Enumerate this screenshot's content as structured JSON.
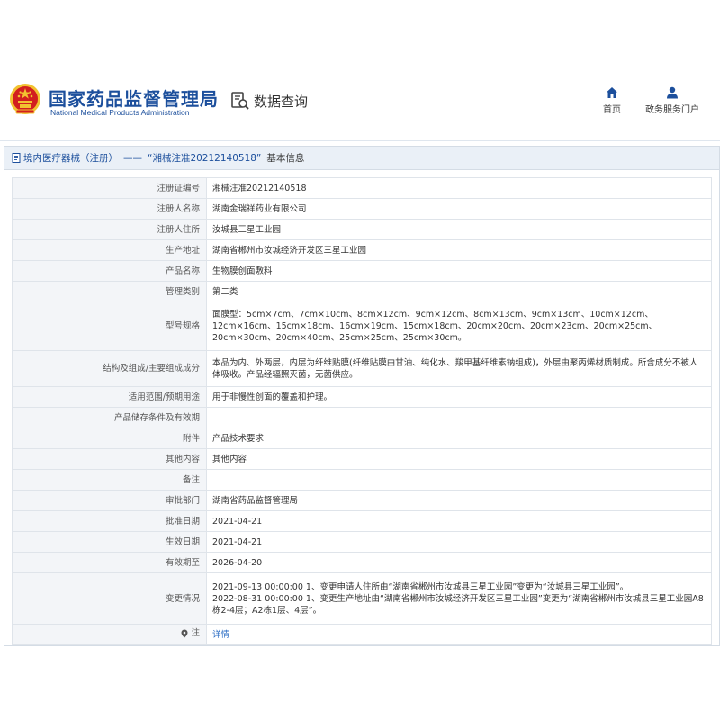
{
  "header": {
    "title": "国家药品监督管理局",
    "subtitle": "National Medical Products Administration",
    "query_label": "数据查询",
    "nav": {
      "home_label": "首页",
      "portal_label": "政务服务门户"
    }
  },
  "section": {
    "category": "境内医疗器械（注册）",
    "dash": "——",
    "record_quoted": "“湘械注准20212140518”",
    "suffix": "基本信息"
  },
  "rows": [
    {
      "label": "注册证编号",
      "value": "湘械注准20212140518"
    },
    {
      "label": "注册人名称",
      "value": "湖南金瑞祥药业有限公司"
    },
    {
      "label": "注册人住所",
      "value": "汝城县三星工业园"
    },
    {
      "label": "生产地址",
      "value": "湖南省郴州市汝城经济开发区三星工业园"
    },
    {
      "label": "产品名称",
      "value": "生物膜创面敷料"
    },
    {
      "label": "管理类别",
      "value": "第二类"
    },
    {
      "label": "型号规格",
      "value": "面膜型：5cm×7cm、7cm×10cm、8cm×12cm、9cm×12cm、8cm×13cm、9cm×13cm、10cm×12cm、12cm×16cm、15cm×18cm、16cm×19cm、15cm×18cm、20cm×20cm、20cm×23cm、20cm×25cm、20cm×30cm、20cm×40cm、25cm×25cm、25cm×30cm。"
    },
    {
      "label": "结构及组成/主要组成成分",
      "value": "本品为内、外两层，内层为纤维贴膜(纤维贴膜由甘油、纯化水、羧甲基纤维素钠组成)，外层由聚丙烯材质制成。所含成分不被人体吸收。产品经辐照灭菌，无菌供应。"
    },
    {
      "label": "适用范围/预期用途",
      "value": "用于非慢性创面的覆盖和护理。"
    },
    {
      "label": "产品储存条件及有效期",
      "value": ""
    },
    {
      "label": "附件",
      "value": "产品技术要求"
    },
    {
      "label": "其他内容",
      "value": "其他内容"
    },
    {
      "label": "备注",
      "value": ""
    },
    {
      "label": "审批部门",
      "value": "湖南省药品监督管理局"
    },
    {
      "label": "批准日期",
      "value": "2021-04-21"
    },
    {
      "label": "生效日期",
      "value": "2021-04-21"
    },
    {
      "label": "有效期至",
      "value": "2026-04-20"
    },
    {
      "label": "变更情况",
      "lines": [
        "2021-09-13 00:00:00 1、变更申请人住所由“湖南省郴州市汝城县三星工业园”变更为“汝城县三星工业园”。",
        "2022-08-31 00:00:00 1、变更生产地址由“湖南省郴州市汝城经济开发区三星工业园”变更为“湖南省郴州市汝城县三星工业园A8栋2-4层；A2栋1层、4层”。"
      ]
    },
    {
      "label": "注",
      "value": "详情"
    }
  ],
  "icons": {
    "emblem": "national-emblem-icon",
    "query": "document-search-icon",
    "home": "home-icon",
    "portal": "user-icon",
    "section": "document-icon",
    "note": "location-pin-icon"
  },
  "colors": {
    "brand_blue": "#1c4f9c",
    "emblem_red": "#d21f1f",
    "emblem_gold": "#f2c230",
    "link_blue": "#2a6cc4",
    "label_bg": "#f3f5f8",
    "section_bar_bg": "#eaf0f7"
  }
}
